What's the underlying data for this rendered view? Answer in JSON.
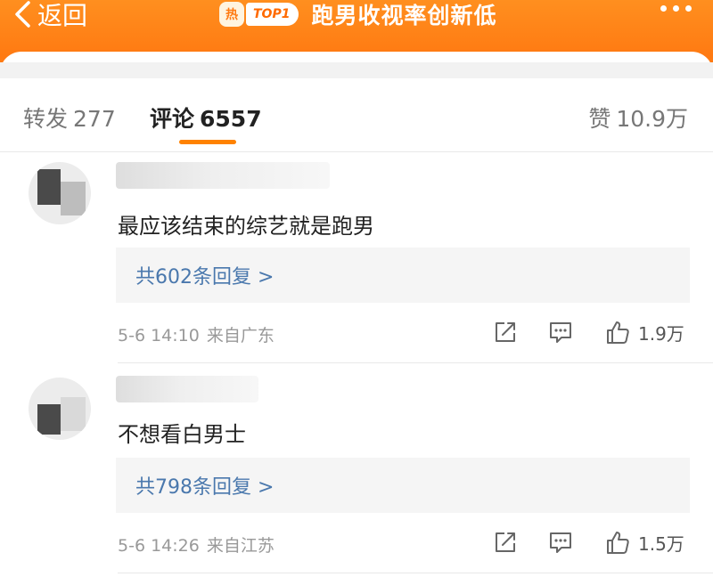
{
  "header": {
    "back_label": "返回",
    "hot_badge": "热",
    "rank_badge": "TOP1",
    "title": "跑男收视率创新低"
  },
  "tabs": {
    "repost": {
      "label": "转发",
      "count": "277"
    },
    "comment": {
      "label": "评论",
      "count": "6557"
    },
    "like": {
      "label": "赞",
      "count": "10.9万"
    }
  },
  "colors": {
    "header_orange": "#ff7a12",
    "active_tab_underline": "#ff8200",
    "reply_link": "#4a78ad"
  },
  "comments": [
    {
      "text": "最应该结束的综艺就是跑男",
      "replies_label": "共602条回复 >",
      "time": "5-6 14:10",
      "location": "来自广东",
      "likes": "1.9万"
    },
    {
      "text": "不想看白男士",
      "replies_label": "共798条回复 >",
      "time": "5-6 14:26",
      "location": "来自江苏",
      "likes": "1.5万"
    }
  ],
  "icons": {
    "back": "chevron-left-icon",
    "more": "more-dots-icon",
    "share": "share-icon",
    "reply": "comment-bubble-icon",
    "like": "thumbs-up-icon"
  }
}
